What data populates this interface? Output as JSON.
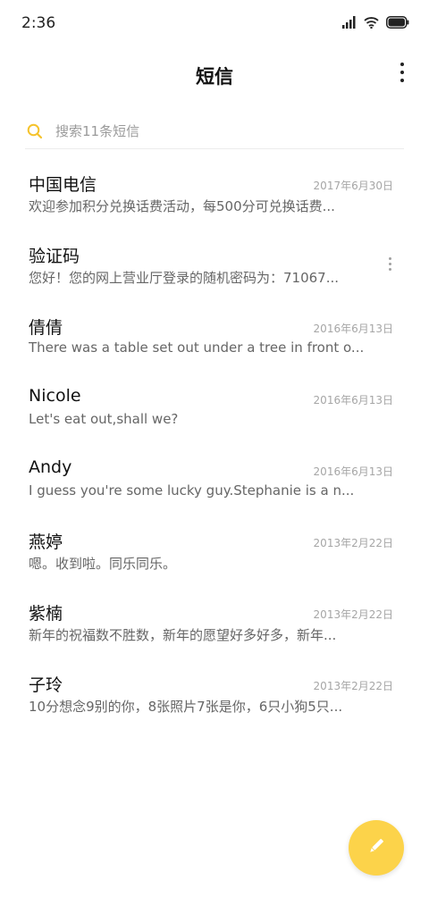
{
  "status_bar": {
    "time": "2:36",
    "icons": [
      "signal-icon",
      "wifi-icon",
      "battery-icon"
    ]
  },
  "header": {
    "title": "短信",
    "more_icon": "more-vertical-icon"
  },
  "search": {
    "placeholder": "搜索11条短信",
    "value": "",
    "icon": "search-icon"
  },
  "conversations": [
    {
      "name": "中国电信",
      "date": "2017年6月30日",
      "preview": "欢迎参加积分兑换话费活动，每500分可兑换话费..."
    },
    {
      "name": "验证码",
      "date": "",
      "preview": "您好！您的网上营业厅登录的随机密码为：71067..."
    },
    {
      "name": "倩倩",
      "date": "2016年6月13日",
      "preview": "There was a table set out under a tree in front o..."
    },
    {
      "name": "Nicole",
      "date": "2016年6月13日",
      "preview": "Let's eat out,shall we?"
    },
    {
      "name": "Andy",
      "date": "2016年6月13日",
      "preview": "I guess you're some lucky guy.Stephanie is a n..."
    },
    {
      "name": "燕婷",
      "date": "2013年2月22日",
      "preview": "嗯。收到啦。同乐同乐。"
    },
    {
      "name": "紫楠",
      "date": "2013年2月22日",
      "preview": "新年的祝福数不胜数，新年的愿望好多好多，新年..."
    },
    {
      "name": "子玲",
      "date": "2013年2月22日",
      "preview": "10分想念9别的你，8张照片7张是你，6只小狗5只..."
    }
  ],
  "fab": {
    "icon": "compose-pencil-icon"
  },
  "colors": {
    "accent": "#fcd34a",
    "search_icon": "#f5c32c",
    "date_text": "#a6a6a6",
    "preview_text": "#666666"
  }
}
